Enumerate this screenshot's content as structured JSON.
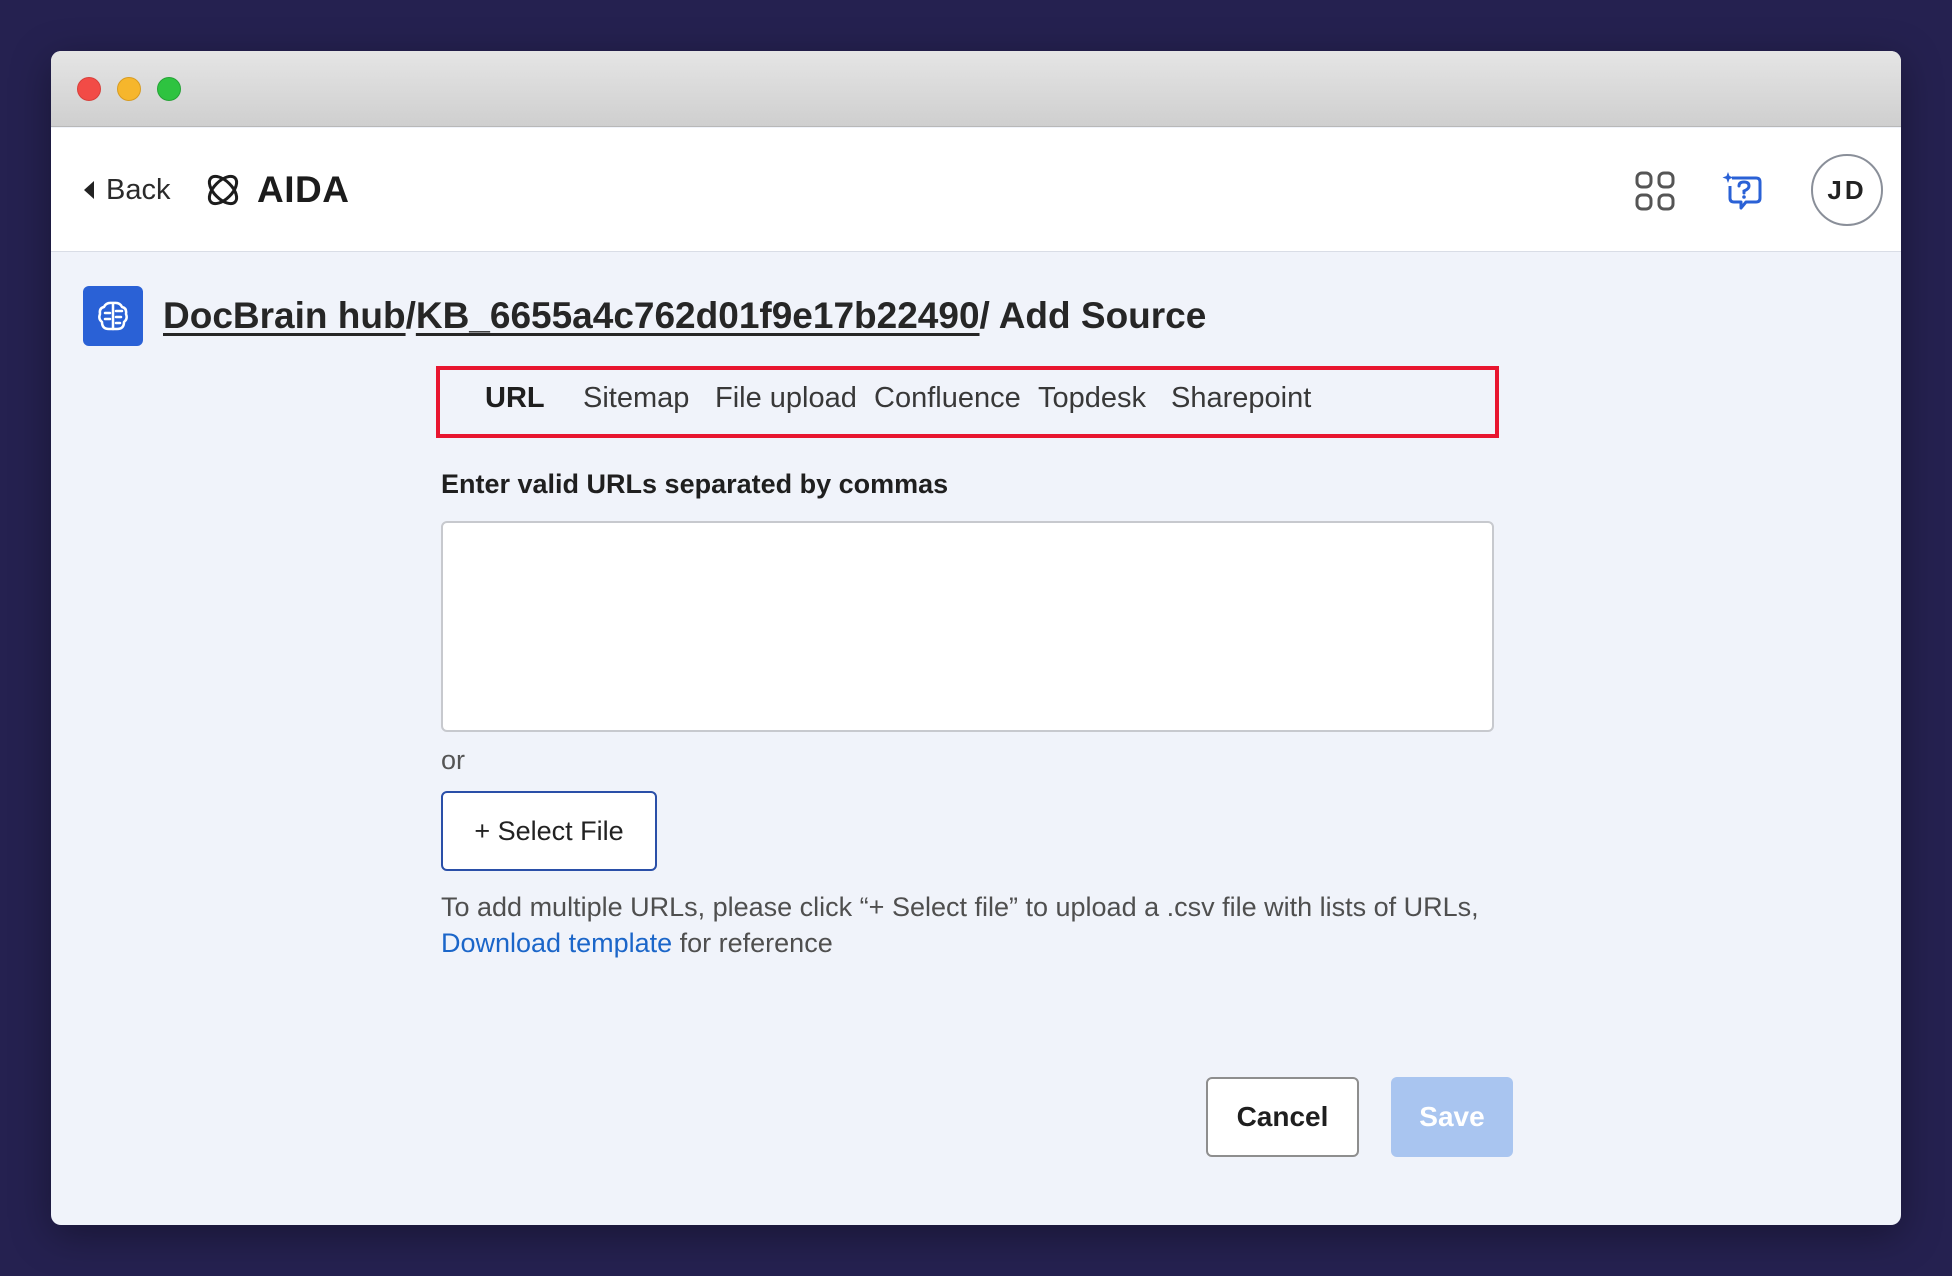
{
  "header": {
    "back_label": "Back",
    "app_name": "AIDA",
    "avatar_initials": "JD"
  },
  "breadcrumb": {
    "hub": "DocBrain hub",
    "kb": "KB_6655a4c762d01f9e17b22490",
    "current": "/ Add Source"
  },
  "tabs": [
    {
      "label": "URL",
      "active": true
    },
    {
      "label": "Sitemap",
      "active": false
    },
    {
      "label": "File upload",
      "active": false
    },
    {
      "label": "Confluence",
      "active": false
    },
    {
      "label": "Topdesk",
      "active": false
    },
    {
      "label": "Sharepoint",
      "active": false
    }
  ],
  "form": {
    "url_label": "Enter valid URLs separated by commas",
    "url_value": "",
    "or_text": "or",
    "select_file_label": "+ Select File",
    "help_text": "To add multiple URLs, please click “+ Select file” to upload a .csv file with lists of URLs,",
    "download_link": "Download template",
    "help_suffix": " for reference"
  },
  "actions": {
    "cancel_label": "Cancel",
    "save_label": "Save"
  },
  "colors": {
    "accent": "#2a61d6",
    "highlight_border": "#e8152f",
    "save_disabled": "#a9c5f0"
  }
}
